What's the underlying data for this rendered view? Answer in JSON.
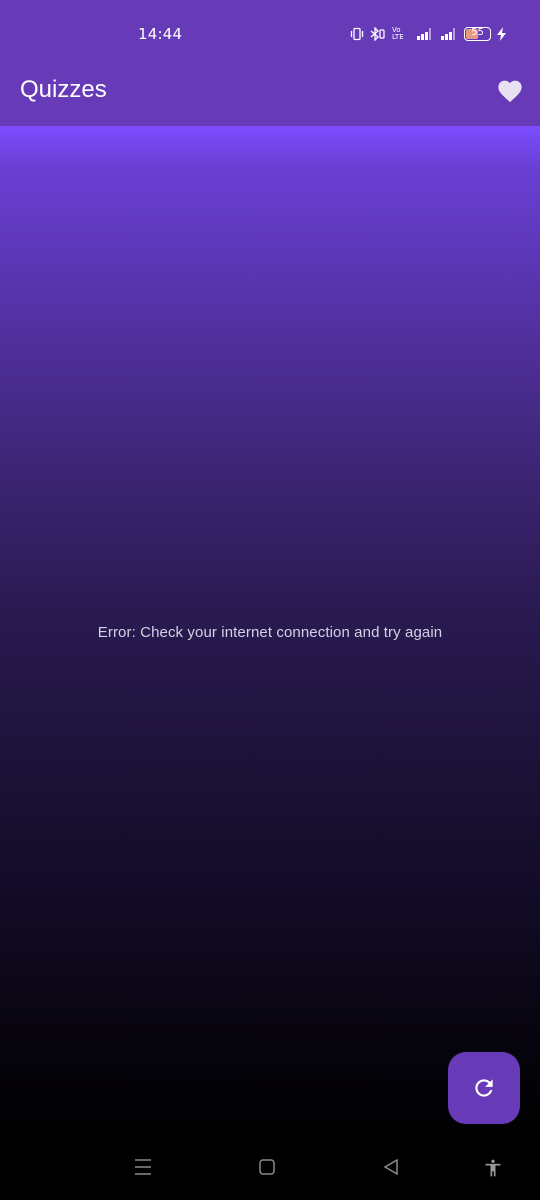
{
  "status_bar": {
    "time": "14:44",
    "icons": [
      "vibrate-icon",
      "bluetooth-icon",
      "volte-icon",
      "signal-icon",
      "signal-icon",
      "battery-icon",
      "charging-icon"
    ],
    "volte_label": "Vo LTE",
    "battery_level": "55",
    "battery_fraction": 0.55
  },
  "app_bar": {
    "title": "Quizzes",
    "favorite_icon": "heart-icon"
  },
  "main": {
    "error_message": "Error: Check your internet connection and try again"
  },
  "fab": {
    "icon": "refresh-icon"
  },
  "nav_bar": {
    "items": [
      "menu-icon",
      "home-icon",
      "back-icon",
      "accessibility-icon"
    ]
  },
  "colors": {
    "primary": "#673ab7",
    "gradient_top": "#7c4dff",
    "gradient_bottom": "#000000",
    "error_text": "#d6d0e6"
  }
}
